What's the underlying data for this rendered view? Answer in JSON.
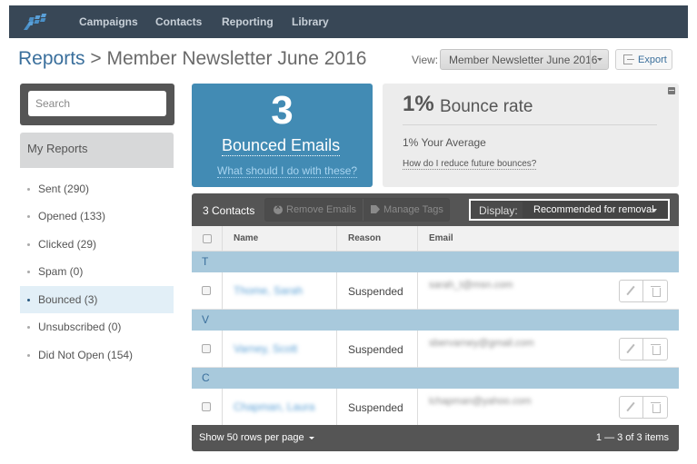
{
  "nav": {
    "logo": "brand-logo",
    "items": [
      "Campaigns",
      "Contacts",
      "Reporting",
      "Library"
    ]
  },
  "breadcrumb": {
    "root": "Reports",
    "separator": " > ",
    "current": "Member Newsletter June 2016"
  },
  "view": {
    "label": "View:",
    "selected": "Member Newsletter June 2016"
  },
  "export_label": "Export",
  "sidebar": {
    "search_placeholder": "Search",
    "section_title": "My Reports",
    "items": [
      {
        "label": "Sent (290)",
        "active": false
      },
      {
        "label": "Opened (133)",
        "active": false
      },
      {
        "label": "Clicked (29)",
        "active": false
      },
      {
        "label": "Spam (0)",
        "active": false
      },
      {
        "label": "Bounced (3)",
        "active": true
      },
      {
        "label": "Unsubscribed (0)",
        "active": false
      },
      {
        "label": "Did Not Open (154)",
        "active": false
      }
    ]
  },
  "bounce_card": {
    "count": "3",
    "title": "Bounced Emails",
    "help_link": "What should I do with these?"
  },
  "rate_card": {
    "rate": "1%",
    "rate_label": "Bounce rate",
    "average": "1% Your Average",
    "help_link": "How do I reduce future bounces?"
  },
  "table": {
    "contacts_count": "3 Contacts",
    "remove_emails": "Remove Emails",
    "manage_tags": "Manage Tags",
    "display_label": "Display:",
    "display_value": "Recommended for removal",
    "columns": [
      "Name",
      "Reason",
      "Email"
    ],
    "groups": [
      {
        "letter": "T",
        "rows": [
          {
            "name": "Thome, Sarah",
            "reason": "Suspended",
            "email": "sarah_t@msn.com"
          }
        ]
      },
      {
        "letter": "V",
        "rows": [
          {
            "name": "Varney, Scott",
            "reason": "Suspended",
            "email": "sbervarney@gmail.com"
          }
        ]
      },
      {
        "letter": "C",
        "rows": [
          {
            "name": "Chapman, Laura",
            "reason": "Suspended",
            "email": "lchapman@yahoo.com"
          }
        ]
      }
    ],
    "footer": {
      "rows_per_page": "Show 50 rows per page",
      "pagination": "1 — 3 of 3 items"
    }
  },
  "colors": {
    "nav_bg": "#384756",
    "accent_blue": "#428bb4",
    "link_blue": "#3a6f9c",
    "group_row": "#a8c9dc",
    "toolbar_dark": "#555555"
  }
}
